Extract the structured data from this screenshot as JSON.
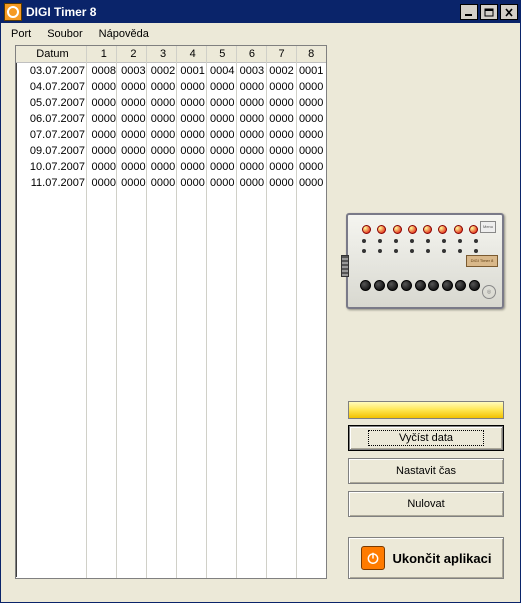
{
  "titlebar": {
    "title": "DIGI Timer 8"
  },
  "menubar": {
    "items": [
      "Port",
      "Soubor",
      "Nápověda"
    ]
  },
  "table": {
    "headers": [
      "Datum",
      "1",
      "2",
      "3",
      "4",
      "5",
      "6",
      "7",
      "8"
    ],
    "rows": [
      {
        "date": "03.07.2007",
        "v": [
          "0008",
          "0003",
          "0002",
          "0001",
          "0004",
          "0003",
          "0002",
          "0001"
        ]
      },
      {
        "date": "04.07.2007",
        "v": [
          "0000",
          "0000",
          "0000",
          "0000",
          "0000",
          "0000",
          "0000",
          "0000"
        ]
      },
      {
        "date": "05.07.2007",
        "v": [
          "0000",
          "0000",
          "0000",
          "0000",
          "0000",
          "0000",
          "0000",
          "0000"
        ]
      },
      {
        "date": "06.07.2007",
        "v": [
          "0000",
          "0000",
          "0000",
          "0000",
          "0000",
          "0000",
          "0000",
          "0000"
        ]
      },
      {
        "date": "07.07.2007",
        "v": [
          "0000",
          "0000",
          "0000",
          "0000",
          "0000",
          "0000",
          "0000",
          "0000"
        ]
      },
      {
        "date": "09.07.2007",
        "v": [
          "0000",
          "0000",
          "0000",
          "0000",
          "0000",
          "0000",
          "0000",
          "0000"
        ]
      },
      {
        "date": "10.07.2007",
        "v": [
          "0000",
          "0000",
          "0000",
          "0000",
          "0000",
          "0000",
          "0000",
          "0000"
        ]
      },
      {
        "date": "11.07.2007",
        "v": [
          "0000",
          "0000",
          "0000",
          "0000",
          "0000",
          "0000",
          "0000",
          "0000"
        ]
      }
    ]
  },
  "device": {
    "label": "DIGI Timer 8",
    "menu": "Menu"
  },
  "buttons": {
    "read": "Vyčíst data",
    "settime": "Nastavit čas",
    "reset": "Nulovat",
    "quit": "Ukončit aplikaci"
  }
}
